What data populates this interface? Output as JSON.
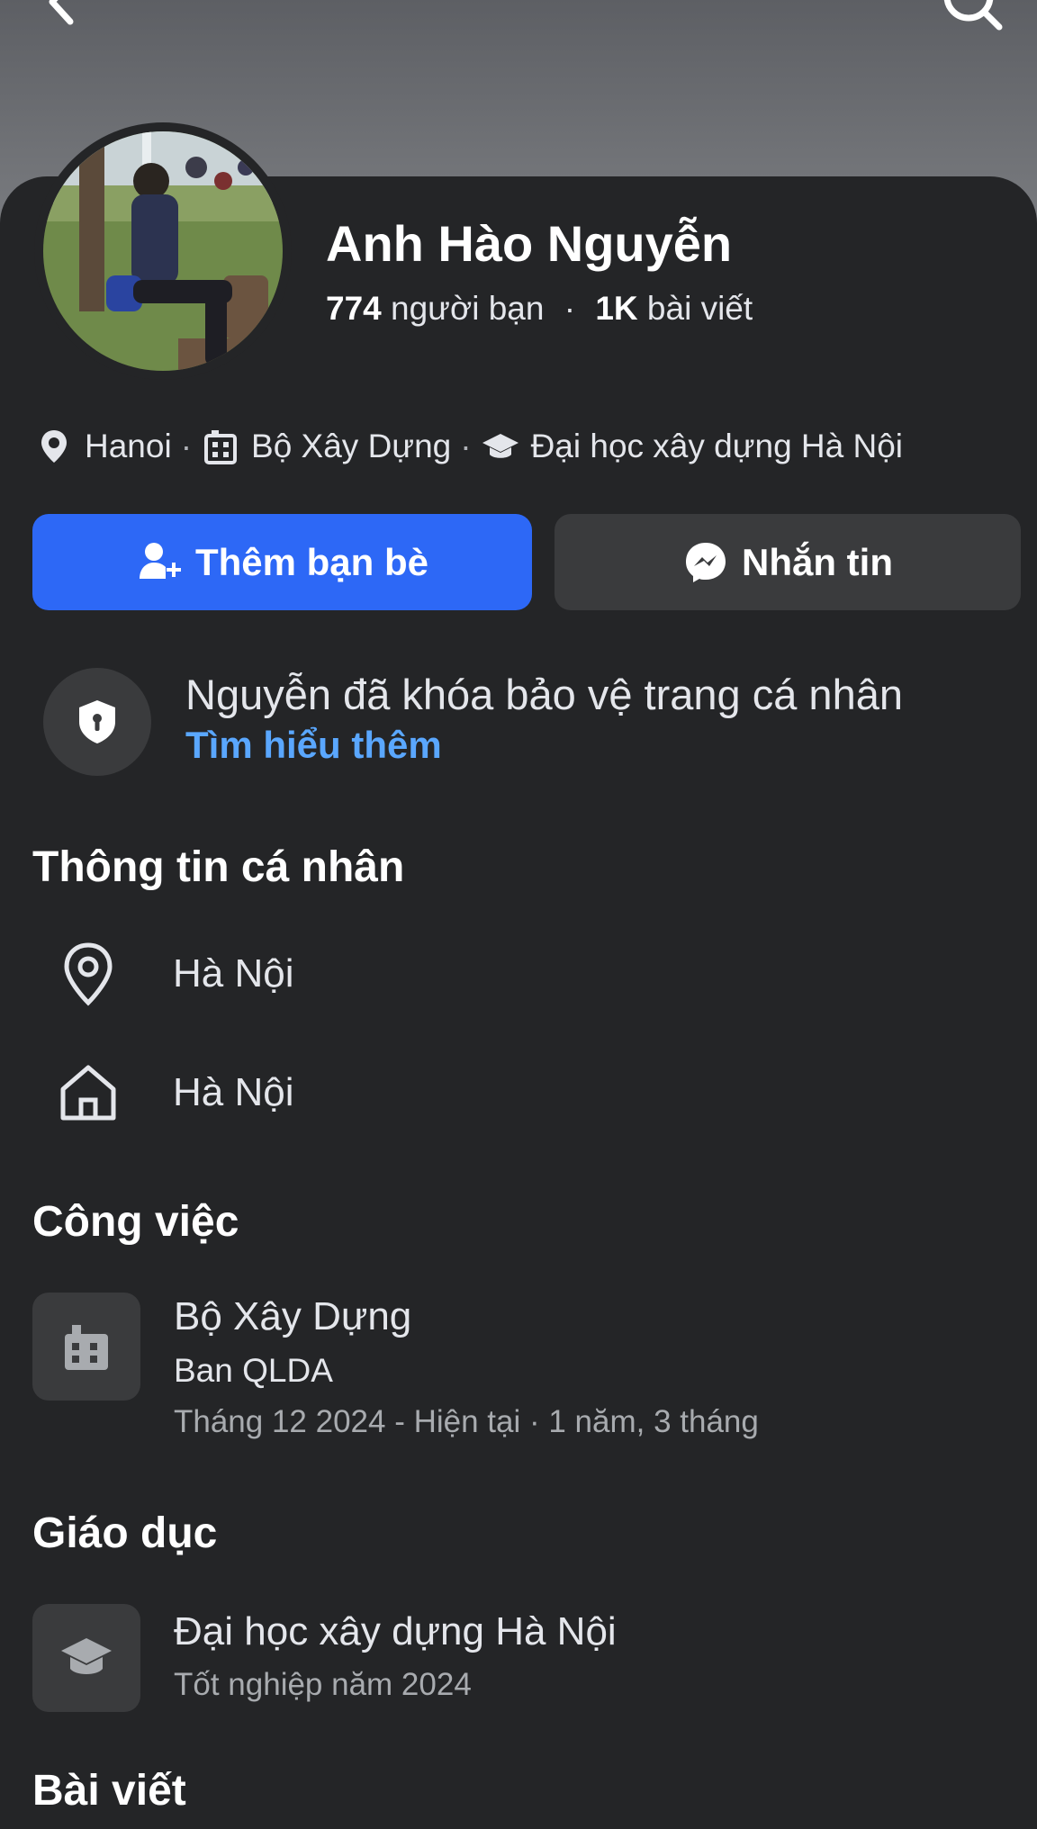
{
  "profile": {
    "name": "Anh Hào Nguyễn",
    "friends_count": "774",
    "friends_label": "người bạn",
    "separator": "·",
    "posts_count": "1K",
    "posts_label": "bài viết"
  },
  "meta": {
    "location": "Hanoi",
    "work": "Bộ Xây Dựng",
    "school": "Đại học xây dựng Hà Nội",
    "dot": "·"
  },
  "actions": {
    "add_friend": "Thêm bạn bè",
    "message": "Nhắn tin"
  },
  "lock_notice": {
    "text": "Nguyễn đã khóa bảo vệ trang cá nhân",
    "link": "Tìm hiểu thêm"
  },
  "personal_info": {
    "title": "Thông tin cá nhân",
    "current_city": "Hà Nội",
    "hometown": "Hà Nội"
  },
  "work": {
    "title": "Công việc",
    "employer": "Bộ Xây Dựng",
    "position": "Ban QLDA",
    "period": "Tháng 12 2024 - Hiện tại · 1 năm, 3 tháng"
  },
  "education": {
    "title": "Giáo dục",
    "school": "Đại học xây dựng Hà Nội",
    "detail": "Tốt nghiệp năm 2024"
  },
  "posts": {
    "title": "Bài viết"
  },
  "colors": {
    "background": "#242527",
    "primary_button": "#2d68f6",
    "secondary_button": "#3a3b3d",
    "link": "#5aa7ff",
    "muted_text": "#a8abaf"
  },
  "icons": [
    "back-arrow-icon",
    "search-icon",
    "location-pin-icon",
    "building-icon",
    "graduation-cap-icon",
    "add-friend-icon",
    "messenger-icon",
    "shield-lock-icon",
    "home-icon"
  ]
}
